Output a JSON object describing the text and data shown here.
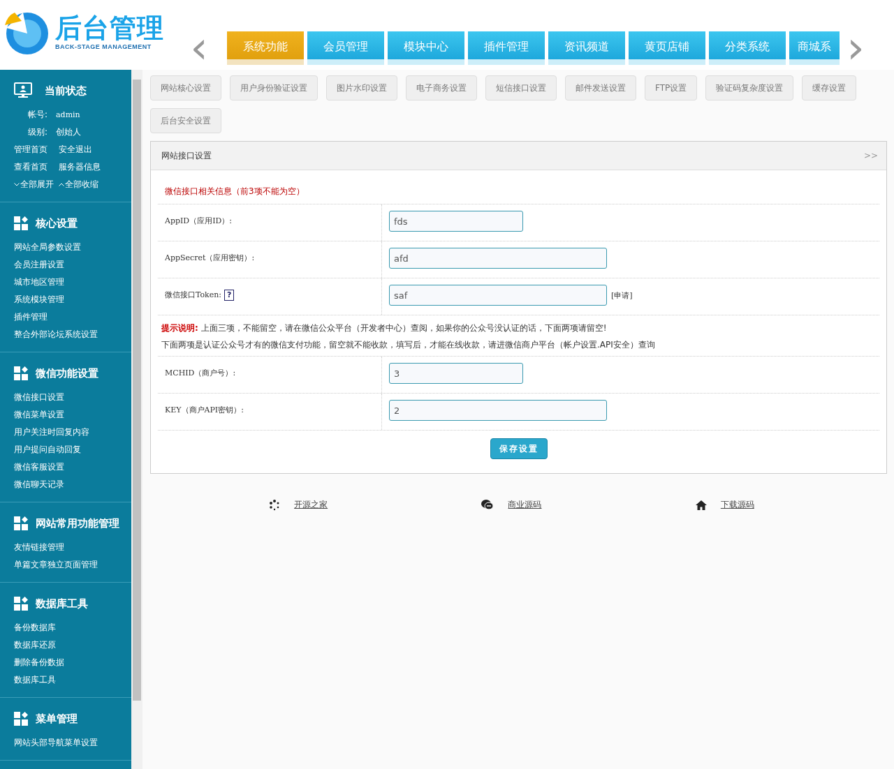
{
  "logo": {
    "title": "后台管理",
    "subtitle": "BACK-STAGE MANAGEMENT"
  },
  "nav": {
    "prev": "‹",
    "next": "›",
    "tabs": [
      {
        "label": "系统功能",
        "selected": true
      },
      {
        "label": "会员管理",
        "selected": false
      },
      {
        "label": "模块中心",
        "selected": false
      },
      {
        "label": "插件管理",
        "selected": false
      },
      {
        "label": "资讯频道",
        "selected": false
      },
      {
        "label": "黄页店铺",
        "selected": false
      },
      {
        "label": "分类系统",
        "selected": false
      },
      {
        "label": "商城系",
        "selected": false
      }
    ]
  },
  "sidebar": {
    "status": {
      "title": "当前状态",
      "account_label": "帐号:",
      "account": "admin",
      "level_label": "级别:",
      "level": "创始人",
      "links": [
        "管理首页",
        "安全退出",
        "查看首页",
        "服务器信息",
        "全部展开",
        "全部收缩"
      ]
    },
    "sections": [
      {
        "title": "核心设置",
        "items": [
          "网站全局参数设置",
          "会员注册设置",
          "城市地区管理",
          "系统模块管理",
          "插件管理",
          "整合外部论坛系统设置"
        ]
      },
      {
        "title": "微信功能设置",
        "items": [
          "微信接口设置",
          "微信菜单设置",
          "用户关注时回复内容",
          "用户提问自动回复",
          "微信客服设置",
          "微信聊天记录"
        ]
      },
      {
        "title": "网站常用功能管理",
        "items": [
          "友情链接管理",
          "单篇文章独立页面管理"
        ]
      },
      {
        "title": "数据库工具",
        "items": [
          "备份数据库",
          "数据库还原",
          "删除备份数据",
          "数据库工具"
        ]
      },
      {
        "title": "菜单管理",
        "items": [
          "网站头部导航菜单设置"
        ]
      }
    ]
  },
  "sub_tabs": [
    "网站核心设置",
    "用户身份验证设置",
    "图片水印设置",
    "电子商务设置",
    "短信接口设置",
    "邮件发送设置",
    "FTP设置",
    "验证码复杂度设置",
    "缓存设置",
    "后台安全设置"
  ],
  "panel": {
    "title": "网站接口设置",
    "toggle": ">>",
    "notice": "微信接口相关信息（前3项不能为空）",
    "fields": [
      {
        "label": "AppID（应用ID）:",
        "value": "fds"
      },
      {
        "label": "AppSecret（应用密钥）:",
        "value": "afd"
      },
      {
        "label": "微信接口Token:",
        "help": "?",
        "value": "saf",
        "link": "[申请]"
      }
    ],
    "tip": {
      "label": "提示说明:",
      "text": "上面三项，不能留空，请在微信公众平台（开发者中心）查阅，如果你的公众号没认证的话，下面两项请留空!"
    },
    "note": "下面两项是认证公众号才有的微信支付功能，留空就不能收款，填写后，才能在线收款，请进微信商户平台（帐户设置.API安全）查询",
    "pay_fields": [
      {
        "label": "MCHID（商户号）:",
        "value": "3"
      },
      {
        "label": "KEY（商户API密钥）:",
        "value": "2"
      }
    ],
    "save": "保存设置"
  },
  "footer_links": [
    "开源之家",
    "商业源码",
    "下载源码"
  ]
}
